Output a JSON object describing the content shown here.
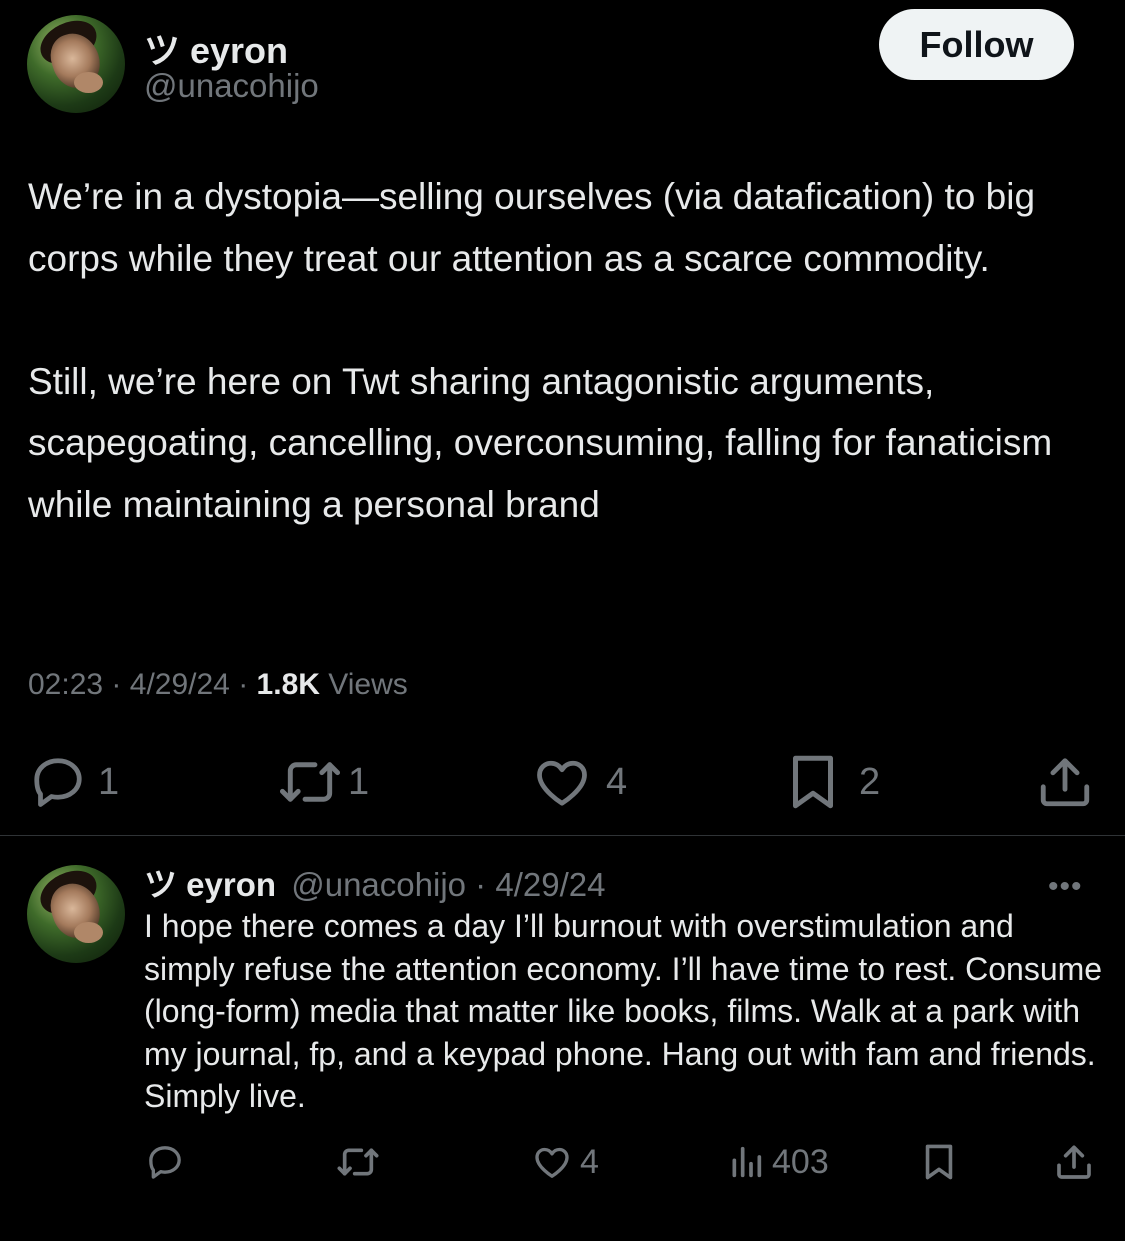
{
  "tweet": {
    "display_name": "ツ eyron",
    "handle": "@unacohijo",
    "follow_label": "Follow",
    "paragraphs": [
      "We’re in a dystopia—selling ourselves (via datafication) to big corps while they treat our attention as a scarce commodity.",
      "Still, we’re here on Twt sharing antagonistic arguments, scapegoating, cancelling, overconsuming, falling for fanaticism while maintaining a personal brand"
    ],
    "time": "02:23",
    "separator": "·",
    "date": "4/29/24",
    "views_count": "1.8K",
    "views_label": "Views",
    "actions": {
      "replies": "1",
      "reposts": "1",
      "likes": "4",
      "bookmarks": "2"
    },
    "icons": [
      "reply-icon",
      "repost-icon",
      "like-icon",
      "bookmark-icon",
      "share-icon"
    ]
  },
  "reply": {
    "display_name": "ツ eyron",
    "handle": "@unacohijo",
    "separator": "·",
    "date": "4/29/24",
    "more_label": "•••",
    "text": "I hope there comes a day I’ll burnout with overstimulation and simply refuse the attention economy. I’ll have time to rest. Consume (long-form) media that matter like books, films. Walk at a park with my journal, fp, and a keypad phone. Hang out with fam and friends. Simply live.",
    "actions": {
      "likes": "4",
      "views": "403"
    },
    "icons": [
      "reply-icon",
      "repost-icon",
      "like-icon",
      "views-icon",
      "bookmark-icon",
      "share-icon"
    ]
  },
  "colors": {
    "background": "#000000",
    "text": "#e7e9ea",
    "secondary": "#71767b",
    "divider": "#2f3336",
    "follow_button_bg": "#eff3f4"
  }
}
